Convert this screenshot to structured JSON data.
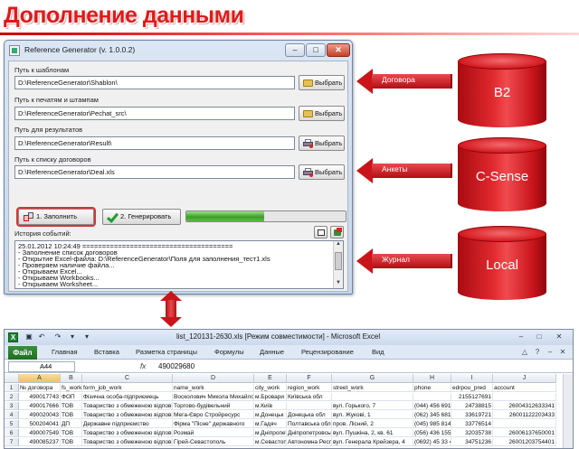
{
  "slide": {
    "title": "Дополнение данными"
  },
  "app": {
    "window_title": "Reference Generator (v. 1.0.0.2)",
    "controls": {
      "minimize": "–",
      "maximize": "□",
      "close": "✕"
    },
    "fields": [
      {
        "label": "Путь к шаблонам",
        "value": "D:\\ReferenceGenerator\\Shablon\\",
        "button": "Выбрать"
      },
      {
        "label": "Путь к печатям и штампам",
        "value": "D:\\ReferenceGenerator\\Pechat_src\\",
        "button": "Выбрать"
      },
      {
        "label": "Путь для результатов",
        "value": "D:\\ReferenceGenerator\\Result\\",
        "button": "Выбрать"
      },
      {
        "label": "Путь к списку договоров",
        "value": "D:\\ReferenceGenerator\\Deal.xls",
        "button": "Выбрать"
      }
    ],
    "fill_button": "1. Заполнить",
    "generate_button": "2. Генерировать",
    "progress": 0.49,
    "log_label": "История событий:",
    "log_lines": [
      "25.01.2012 10:24:49 ======================================",
      "- Заполнение список договоров",
      "- Открытие Excel-файла: D:\\ReferenceGenerator\\Поля для заполнения_тест1.xls",
      "- Проверяем наличие файла...",
      "- Открываем Excel...",
      "- Открываем Workbooks...",
      "- Открываем Worksheet..."
    ]
  },
  "sources": [
    {
      "label": "B2",
      "arrow_label": "Договора"
    },
    {
      "label": "C-Sense",
      "arrow_label": "Анкеты"
    },
    {
      "label": "Local",
      "arrow_label": "Журнал"
    }
  ],
  "excel": {
    "title": "list_120131-2630.xls [Режим совместимости] - Microsoft Excel",
    "logo": "X",
    "file_tab": "Файл",
    "tabs": [
      "Главная",
      "Вставка",
      "Разметка страницы",
      "Формулы",
      "Данные",
      "Рецензирование",
      "Вид"
    ],
    "name_box": "A44",
    "fx": "fx",
    "formula_value": "490029680",
    "columns": [
      "A",
      "B",
      "C",
      "D",
      "E",
      "F",
      "G",
      "H",
      "I",
      "J"
    ],
    "rows": [
      {
        "n": "1",
        "cells": [
          "№ договора",
          "fs_work",
          "form_job_work",
          "name_work",
          "city_work",
          "region_work",
          "street_work",
          "phone",
          "edrpou_pred",
          "account"
        ]
      },
      {
        "n": "2",
        "cells": [
          "490017743",
          "ФОП",
          "Фізична особа-підприємець",
          "Восколович Микола Михайлович",
          "м.Бровари",
          "Київська обл",
          "",
          "",
          "2155127691",
          ""
        ]
      },
      {
        "n": "3",
        "cells": [
          "490017666",
          "ТОВ",
          "Товариство з обмеженою відповідальністю",
          "Торгово-будівельний",
          "м.Київ",
          "",
          "вул. Горького, 7",
          "(044) 456 6917",
          "24738815",
          "26004312633341"
        ]
      },
      {
        "n": "4",
        "cells": [
          "490020043",
          "ТОВ",
          "Товариство з обмеженою відповідальністю",
          "Мега-Євро Стройресурс",
          "м.Донецьк",
          "Донецька обл",
          "вул. Жукові, 1",
          "(062) 345 6817",
          "33619721",
          "26001122203433"
        ]
      },
      {
        "n": "5",
        "cells": [
          "500204041",
          "ДП",
          "Державне підприємство",
          "Фірма \"Пісне\" державного",
          "м.Гадяч",
          "Полтавська обл",
          "пров. Лісний, 2",
          "(045) 985 8140",
          "33776514",
          ""
        ]
      },
      {
        "n": "6",
        "cells": [
          "490007549",
          "ТОВ",
          "Товариство з обмеженою відповідальністю",
          "Розмай",
          "м.Дніпропетровськ",
          "Дніпропетровська",
          "вул. Пушкіна, 2, кв. 61",
          "(056) 436 1553",
          "32035738",
          "26006137650001"
        ]
      },
      {
        "n": "7",
        "cells": [
          "490085237",
          "ТОВ",
          "Товариство з обмеженою відповідальністю",
          "Гірей-Севастополь",
          "м.Севастополь",
          "Автономна Республіка",
          "вул. Генерала Крейзера, 4",
          "(0692) 45 33 41",
          "34751236",
          "26001203754401"
        ]
      }
    ]
  }
}
